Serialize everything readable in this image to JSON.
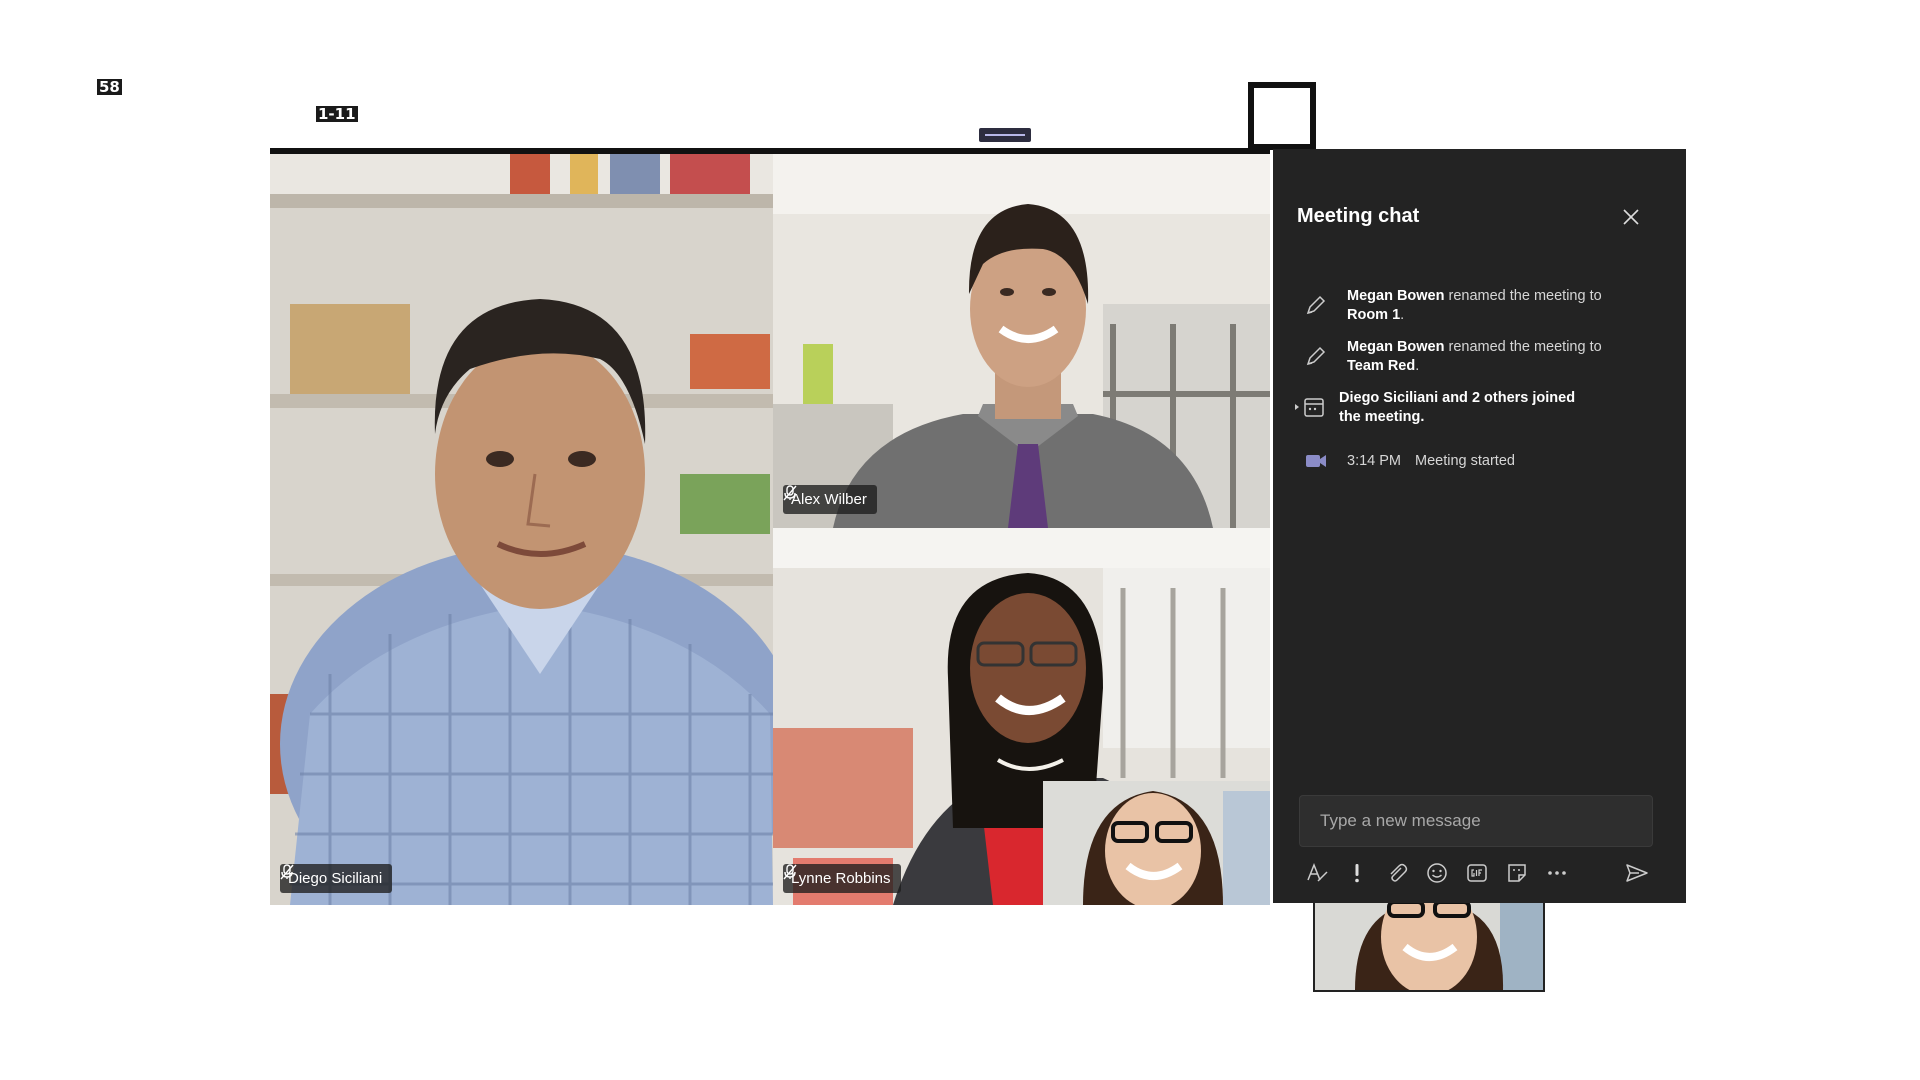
{
  "overlay_labels": {
    "top_left": "58",
    "second": "1-11"
  },
  "participants": [
    {
      "name": "Diego Siciliani"
    },
    {
      "name": "Alex Wilber"
    },
    {
      "name": "Lynne Robbins"
    }
  ],
  "chat": {
    "title": "Meeting chat",
    "messages": [
      {
        "actor": "Megan Bowen",
        "action": " renamed the meeting to ",
        "target": "Room 1",
        "end": "."
      },
      {
        "actor": "Megan Bowen",
        "action": " renamed the meeting to ",
        "target": "Team Red",
        "end": "."
      },
      {
        "actor": "Diego Siciliani",
        "action": " and 2 others joined the meeting."
      },
      {
        "time": "3:14 PM",
        "text": "Meeting started"
      }
    ],
    "compose_placeholder": "Type a new message",
    "toolbar": [
      "format-icon",
      "important-icon",
      "attach-icon",
      "emoji-icon",
      "gif-icon",
      "sticker-icon",
      "more-options-icon",
      "send-icon"
    ]
  },
  "colors": {
    "panel_bg": "#232323",
    "accent_purple": "#8b8cc7"
  }
}
